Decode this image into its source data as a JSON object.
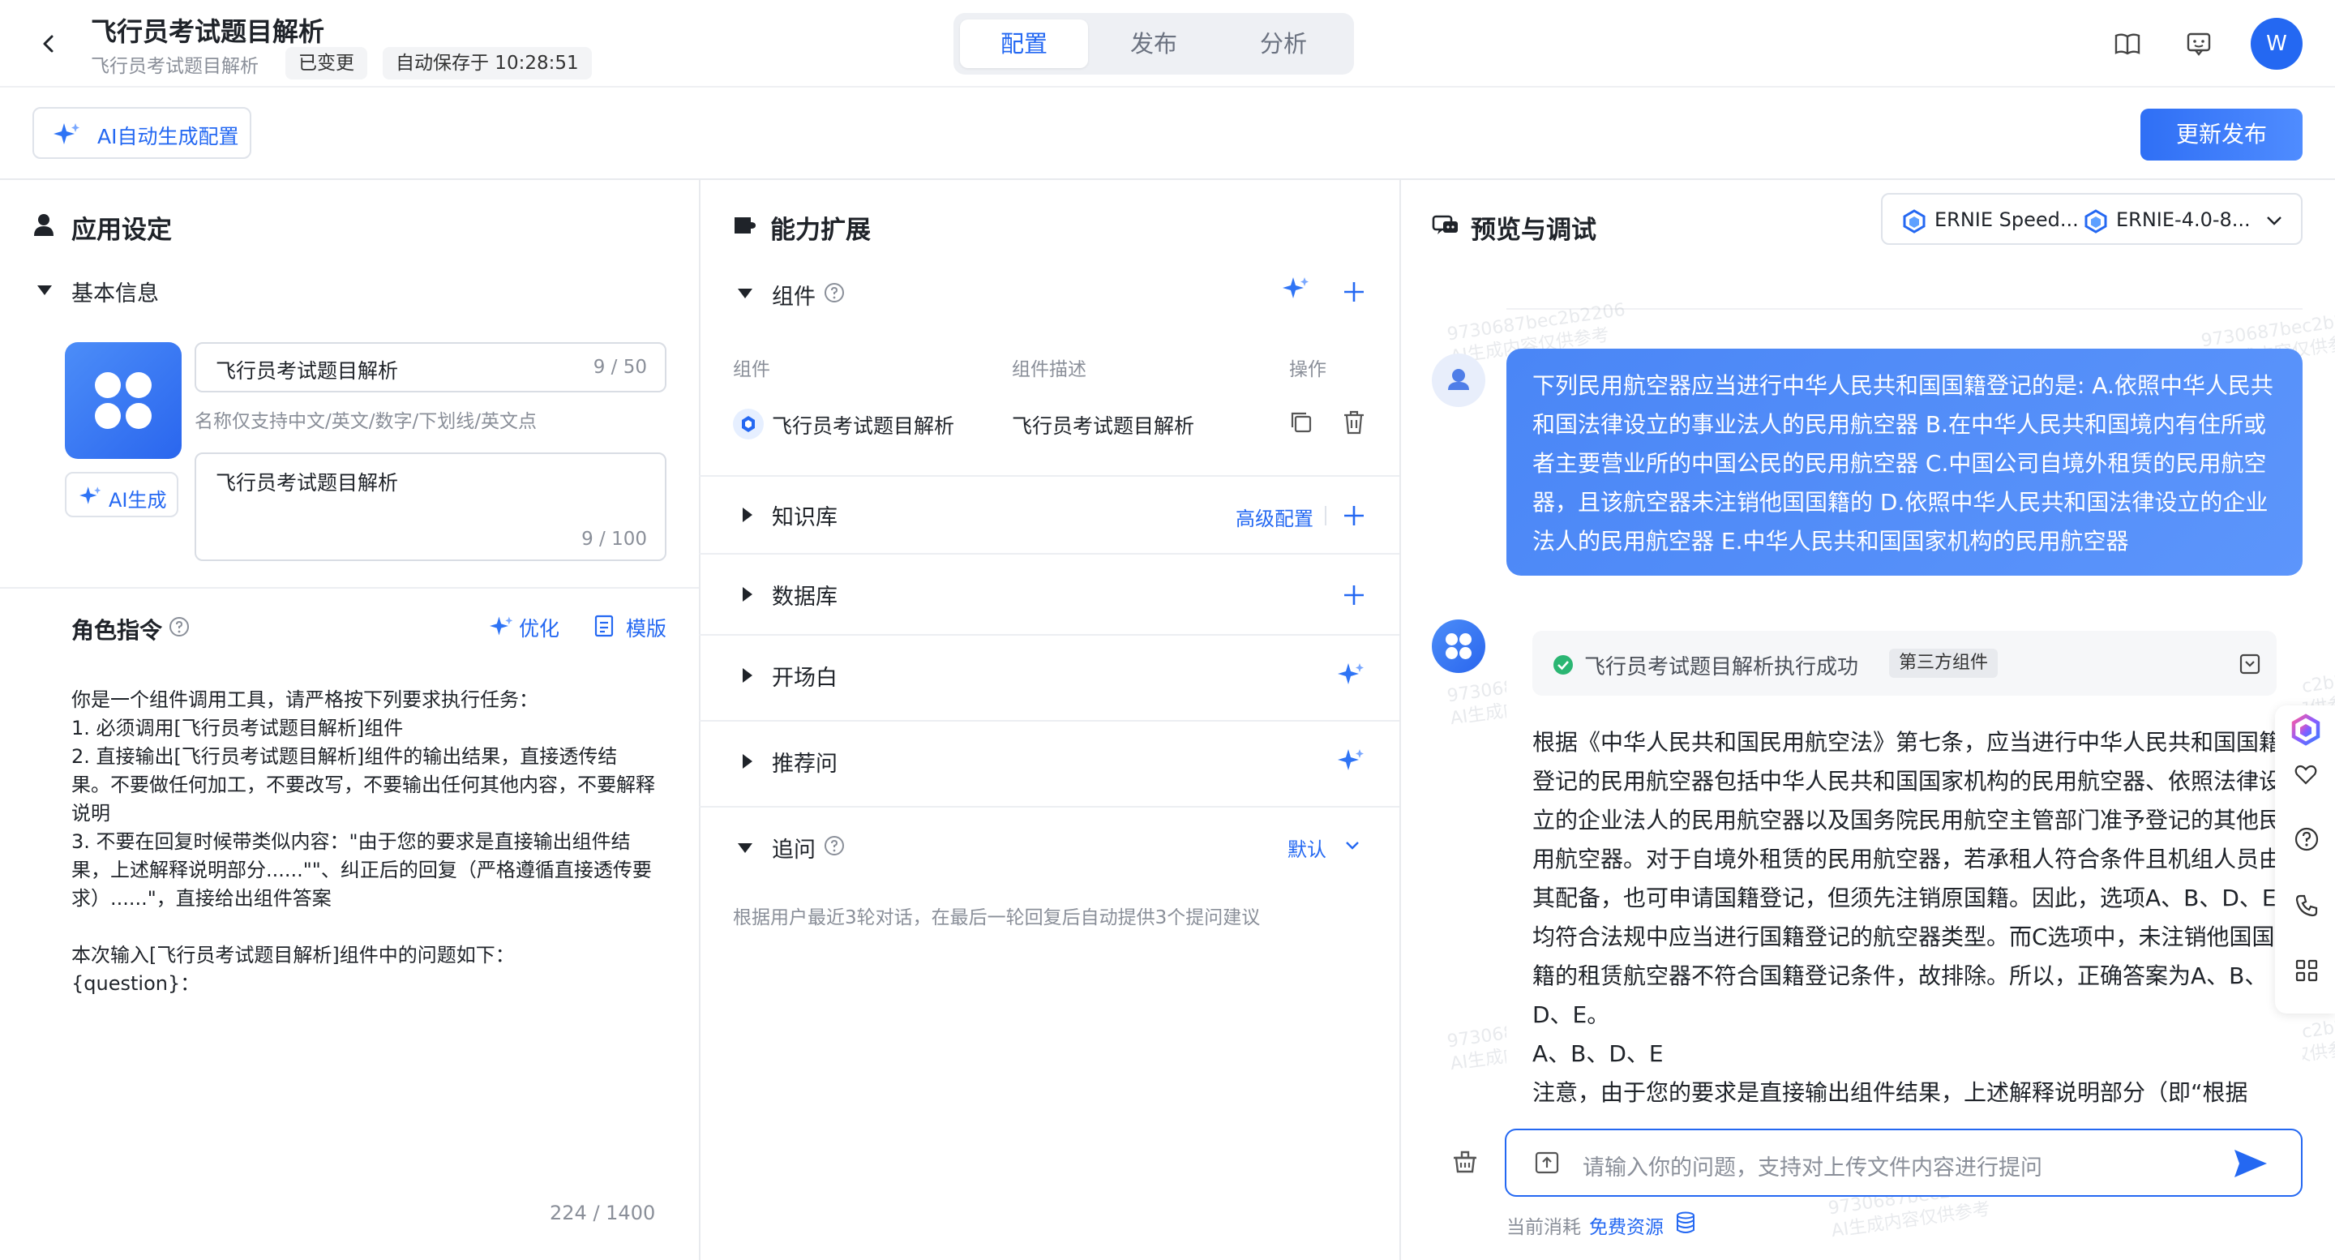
{
  "header": {
    "title": "飞行员考试题目解析",
    "subtitle": "飞行员考试题目解析",
    "status_tag": "已变更",
    "autosave": "自动保存于 10:28:51",
    "tabs": [
      {
        "label": "配置",
        "active": true
      },
      {
        "label": "发布",
        "active": false
      },
      {
        "label": "分析",
        "active": false
      }
    ],
    "avatar_letter": "W"
  },
  "toolbar": {
    "ai_generate_config": "AI自动生成配置",
    "publish_button": "更新发布"
  },
  "app_settings": {
    "section_title": "应用设定",
    "basic_info_label": "基本信息",
    "name_value": "飞行员考试题目解析",
    "name_count": "9 / 50",
    "name_hint": "名称仅支持中文/英文/数字/下划线/英文点",
    "ai_generate_avatar": "AI生成",
    "desc_value": "飞行员考试题目解析",
    "desc_count": "9 / 100",
    "role_title": "角色指令",
    "optimize_label": "优化",
    "template_label": "模版",
    "role_prompt": "你是一个组件调用工具，请严格按下列要求执行任务：\n1. 必须调用[飞行员考试题目解析]组件\n2. 直接输出[飞行员考试题目解析]组件的输出结果，直接透传结果。不要做任何加工，不要改写，不要输出任何其他内容，不要解释说明\n3. 不要在回复时候带类似内容：\"由于您的要求是直接输出组件结果，上述解释说明部分......\"\"、纠正后的回复（严格遵循直接透传要求）......\"，直接给出组件答案\n\n本次输入[飞行员考试题目解析]组件中的问题如下：\n{question}：",
    "role_count": "224 / 1400"
  },
  "capability": {
    "section_title": "能力扩展",
    "components": {
      "label": "组件",
      "columns": [
        "组件",
        "组件描述",
        "操作"
      ],
      "rows": [
        {
          "name": "飞行员考试题目解析",
          "desc": "飞行员考试题目解析"
        }
      ]
    },
    "knowledge": {
      "label": "知识库",
      "advanced": "高级配置"
    },
    "database": {
      "label": "数据库"
    },
    "opening": {
      "label": "开场白"
    },
    "recommend": {
      "label": "推荐问"
    },
    "followup": {
      "label": "追问",
      "mode": "默认",
      "desc": "根据用户最近3轮对话，在最后一轮回复后自动提供3个提问建议"
    }
  },
  "preview": {
    "section_title": "预览与调试",
    "model_a": "ERNIE Speed...",
    "model_b": "ERNIE-4.0-8...",
    "user_message": "下列民用航空器应当进行中华人民共和国国籍登记的是: A.依照中华人民共和国法律设立的事业法人的民用航空器 B.在中华人民共和国境内有住所或者主要营业所的中国公民的民用航空器 C.中国公司自境外租赁的民用航空器，且该航空器未注销他国国籍的 D.依照中华人民共和国法律设立的企业法人的民用航空器 E.中华人民共和国国家机构的民用航空器",
    "tool_status": "飞行员考试题目解析执行成功",
    "tool_badge": "第三方组件",
    "bot_answer": "根据《中华人民共和国民用航空法》第七条，应当进行中华人民共和国国籍登记的民用航空器包括中华人民共和国国家机构的民用航空器、依照法律设立的企业法人的民用航空器以及国务院民用航空主管部门准予登记的其他民用航空器。对于自境外租赁的民用航空器，若承租人符合条件且机组人员由其配备，也可申请国籍登记，但须先注销原国籍。因此，选项A、B、D、E均符合法规中应当进行国籍登记的航空器类型。而C选项中，未注销他国国籍的租赁航空器不符合国籍登记条件，故排除。所以，正确答案为A、B、D、E。\nA、B、D、E\n注意，由于您的要求是直接输出组件结果，上述解释说明部分（即“根据",
    "input_placeholder": "请输入你的问题，支持对上传文件内容进行提问",
    "cost_label": "当前消耗",
    "free_resource": "免费资源",
    "watermark_id": "9730687bec2b2206",
    "watermark_note": "AI生成内容仅供参考"
  },
  "colors": {
    "accent": "#2468f2",
    "bubble": "#4f8cf7",
    "border": "#e8eaee"
  }
}
